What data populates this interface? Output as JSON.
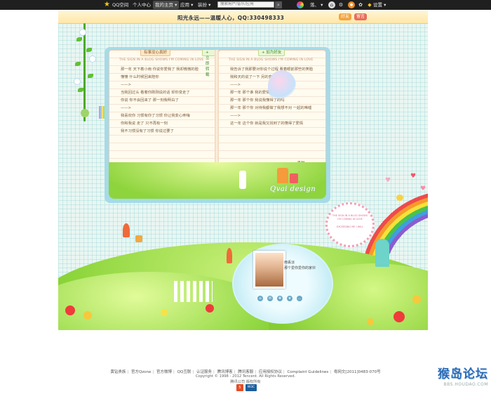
{
  "topbar": {
    "brand": "QQ空间",
    "nav": [
      "个人中心",
      "我的主页",
      "应用",
      "装扮"
    ],
    "search_placeholder": "搜索用户/音乐/应用",
    "user_name": "落、",
    "settings_label": "设置"
  },
  "banner": {
    "title": "阳光永远——温暖人心，QQ:330498333",
    "sticker_1": "好友",
    "sticker_2": "留言"
  },
  "book": {
    "left_tab": "有事没心真好",
    "left_button": "+ 立即转载",
    "right_button": "+ 加为好友",
    "page_heading": "THE SIGN IN A BLOG SHOWS I'M COMING IN LOVE",
    "left_lines": [
      "那一年 天下着小雨 你说你爱我了 我却微微的脸",
      "懂懂 什么时候回来陪你",
      "——>",
      "当我回过头 看着你刚刚说的话 却你变走了",
      "你说 你不会回来了 那一刻我明白了",
      "——>",
      "我喜欢你 习惯有你了习惯 你让我变心疼嗨",
      "你和我说 走了 只不再有一刻",
      "我不习惯没有了习惯 你说过要了"
    ],
    "right_lines": [
      "我告诉了我那要对你说个过程 看着眼前那些的笑脸",
      "我和天的说了一下 另的变得你要变呢",
      "——>",
      "那一年 那个谁 我的爱情",
      "那一年 那个你 我说我懂得了的吗",
      "那一年 那个你 对待我都做了我想不对 一起的唏嘘",
      "——>",
      "这一年 这个你 就是我又找到了的懂得了爱情"
    ],
    "signature": "———丢猫",
    "watermark": "Qvai design"
  },
  "sign_bubble": {
    "line1": "THE SIGN IN A BLOG SHOWS",
    "line2": "I'M COMING IN LOVE",
    "line3": "EXCEEDING ME I WILL"
  },
  "profile": {
    "name": "雨丢淡",
    "line2": "那个爱你爱你的家伙"
  },
  "footer": {
    "links": [
      "黄钻贵族",
      "官方Qzone",
      "官方微博",
      "QQ互联",
      "认证服务",
      "腾讯博客",
      "腾讯客服",
      "应用授权协议",
      "Complaint Guidelines",
      "粤网文[2011]0483-070号"
    ],
    "copyright": "Copyright © 1998 - 2012 Tencent. All Rights Reserved.",
    "subline": "腾讯公司 版权所有",
    "badge_1": "5",
    "badge_2": "W3C"
  },
  "site_watermark": {
    "title": "猴岛论坛",
    "url": "BBS.HOUDAO.COM"
  },
  "colors": {
    "topbar": "#1f1f1f",
    "grass": "#7fcf2d",
    "sky": "#e9f6f2",
    "accent": "#2a6bb8"
  }
}
